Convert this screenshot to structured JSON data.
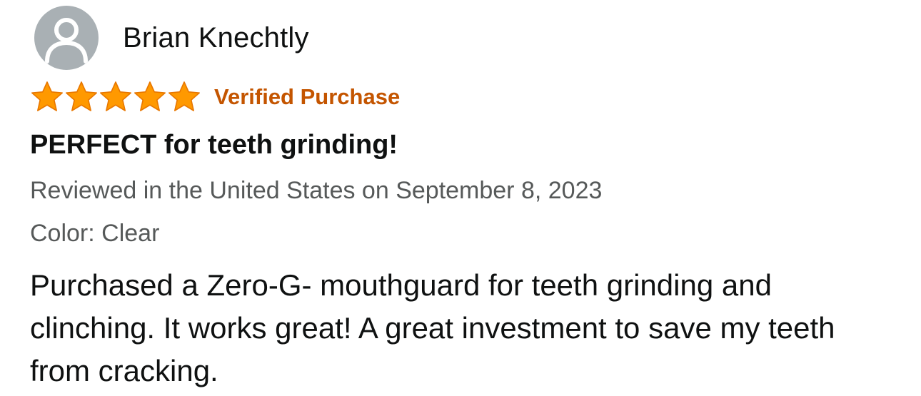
{
  "reviewer": {
    "name": "Brian Knechtly",
    "avatar_icon": "default-user-avatar-icon"
  },
  "rating": {
    "stars": 5,
    "max_stars": 5,
    "star_color": "#ff9900",
    "star_border_color": "#e77600",
    "verified_label": "Verified Purchase",
    "verified_color": "#c45500"
  },
  "review": {
    "title": "PERFECT for teeth grinding!",
    "meta": "Reviewed in the United States on September 8, 2023",
    "variant": "Color: Clear",
    "body": "Purchased a Zero-G- mouthguard for teeth grinding and clinching. It works great! A great investment to save my teeth from cracking."
  },
  "colors": {
    "text_primary": "#0f1111",
    "text_secondary": "#565959",
    "avatar_bg": "#a9b0b4"
  }
}
